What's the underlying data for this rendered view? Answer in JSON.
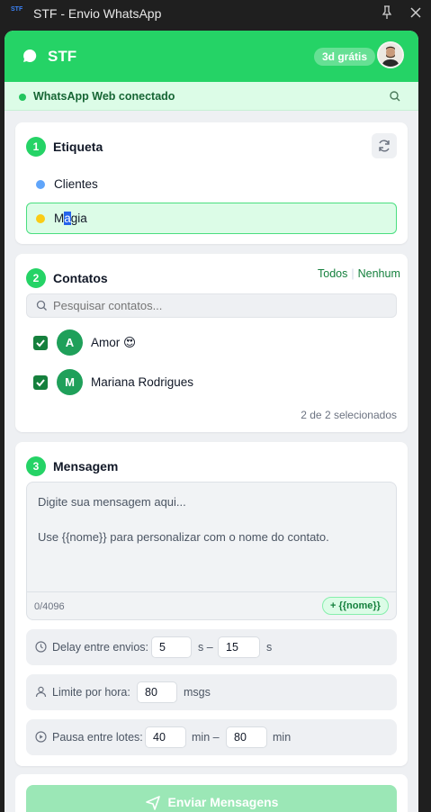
{
  "window": {
    "logo_text": "STF",
    "title": "STF - Envio WhatsApp"
  },
  "header": {
    "brand": "STF",
    "trial_badge": "3d grátis"
  },
  "status": {
    "text": "WhatsApp Web conectado"
  },
  "step1": {
    "number": "1",
    "title": "Etiqueta",
    "tags": [
      {
        "label": "Clientes",
        "color": "#60a5fa",
        "selected": false
      },
      {
        "label_before": "M",
        "label_highlight": "a",
        "label_after": "gia",
        "color": "#facc15",
        "selected": true
      }
    ]
  },
  "step2": {
    "number": "2",
    "title": "Contatos",
    "all_link": "Todos",
    "none_link": "Nenhum",
    "search_placeholder": "Pesquisar contatos...",
    "contacts": [
      {
        "initial": "A",
        "name": "Amor 😍",
        "checked": true
      },
      {
        "initial": "M",
        "name": "Mariana Rodrigues",
        "checked": true
      }
    ],
    "selected_count": "2 de 2 selecionados"
  },
  "step3": {
    "number": "3",
    "title": "Mensagem",
    "placeholder_line1": "Digite sua mensagem aqui...",
    "placeholder_line2": "Use {{nome}} para personalizar com o nome do contato.",
    "char_count": "0/4096",
    "variable_button": "+ {{nome}}",
    "delay": {
      "label": "Delay entre envios:",
      "min": "5",
      "sep": "s –",
      "max": "15",
      "unit": "s"
    },
    "limit": {
      "label": "Limite por hora:",
      "value": "80",
      "unit": "msgs"
    },
    "pause": {
      "label": "Pausa entre lotes:",
      "min": "40",
      "sep": "min –",
      "max": "80",
      "unit": "min"
    }
  },
  "send": {
    "label": "Enviar Mensagens"
  },
  "colors": {
    "brand_green": "#25d366",
    "dark_green": "#15803d",
    "send_disabled": "#9be7b6"
  }
}
